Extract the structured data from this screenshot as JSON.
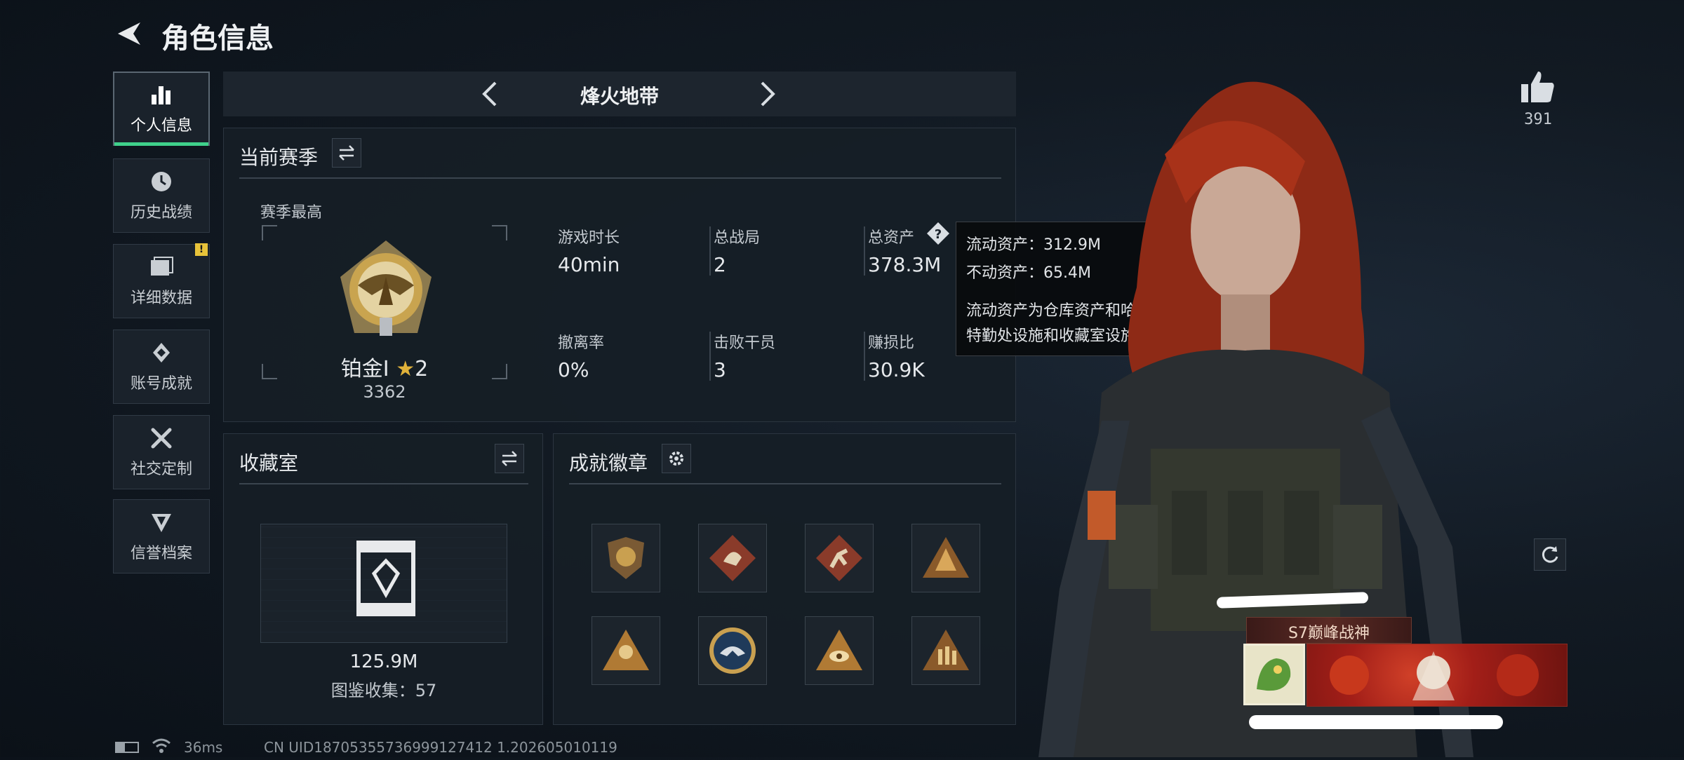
{
  "header": {
    "title": "角色信息"
  },
  "sidebar": {
    "items": [
      {
        "label": "个人信息",
        "active": true,
        "icon": "bar-chart-icon"
      },
      {
        "label": "历史战绩",
        "active": false,
        "icon": "history-icon"
      },
      {
        "label": "详细数据",
        "active": false,
        "icon": "folder-icon",
        "badge": "!"
      },
      {
        "label": "账号成就",
        "active": false,
        "icon": "achievement-icon"
      },
      {
        "label": "社交定制",
        "active": false,
        "icon": "tools-icon"
      },
      {
        "label": "信誉档案",
        "active": false,
        "icon": "credit-icon"
      }
    ]
  },
  "mode_selector": {
    "label": "烽火地带"
  },
  "season": {
    "title": "当前赛季",
    "best_label": "赛季最高",
    "rank_name": "铂金I",
    "rank_stars": "2",
    "rank_points": "3362",
    "stats": [
      {
        "label": "游戏时长",
        "value": "40min"
      },
      {
        "label": "总战局",
        "value": "2"
      },
      {
        "label": "总资产",
        "value": "378.3M"
      },
      {
        "label": "撤离率",
        "value": "0%"
      },
      {
        "label": "击败干员",
        "value": "3"
      },
      {
        "label": "赚损比",
        "value": "30.9K"
      }
    ]
  },
  "tooltip": {
    "line1": "流动资产：312.9M",
    "line2": "不动资产：65.4M",
    "line3": "流动资产为仓库资产和哈夫币，不动资产为",
    "line4": "特勤处设施和收藏室设施"
  },
  "collection": {
    "title": "收藏室",
    "value": "125.9M",
    "count_text": "图鉴收集：57"
  },
  "achievements": {
    "title": "成就徽章",
    "badges": [
      "lion-shield-icon",
      "dragon-diamond-icon",
      "runner-diamond-icon",
      "warning-triangle-icon",
      "soldier-triangle-icon",
      "eagle-circle-icon",
      "eye-triangle-icon",
      "squad-triangle-icon"
    ]
  },
  "likes": {
    "count": "391"
  },
  "character": {
    "title_banner": "S7巅峰战神"
  },
  "status_bar": {
    "ping": "36ms",
    "uid": "CN UID18705355736999127412 1.202605010119"
  },
  "colors": {
    "accent_green": "#3fd18b",
    "star_gold": "#e0b23a",
    "panel_bg": "#161e26"
  }
}
